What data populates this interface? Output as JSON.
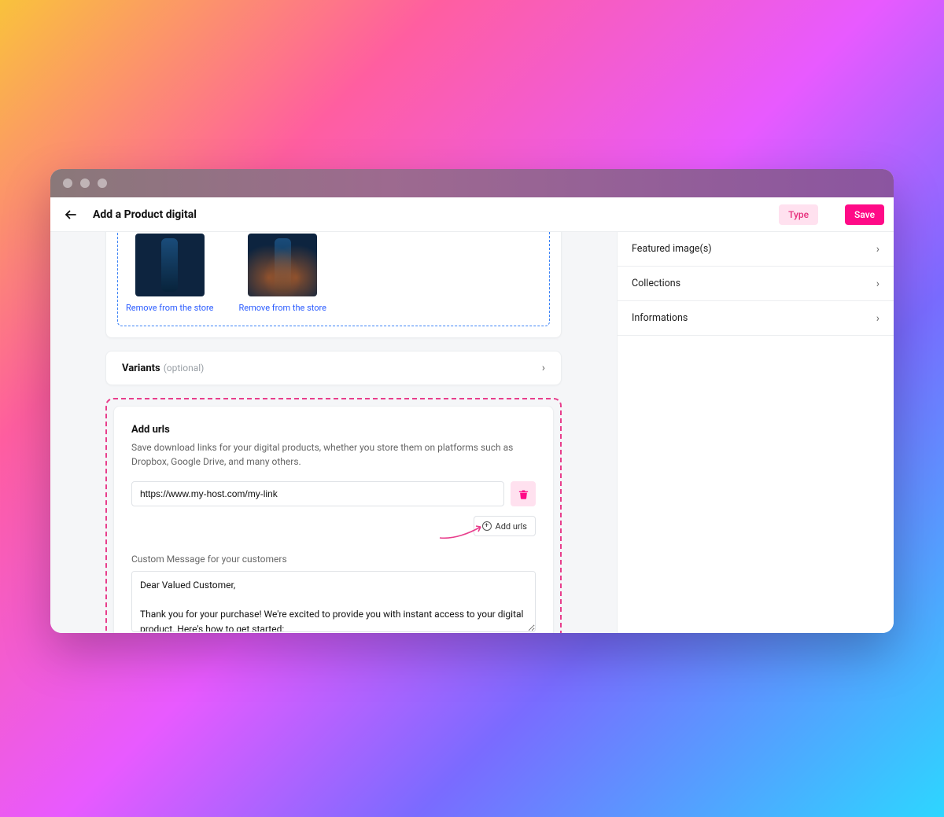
{
  "header": {
    "title": "Add a Product digital",
    "type_label": "Type",
    "save_label": "Save"
  },
  "images_panel": {
    "remove_label": "Remove from the store"
  },
  "variants_panel": {
    "label": "Variants",
    "optional_label": "(optional)"
  },
  "urls_panel": {
    "title": "Add urls",
    "description": "Save download links for your digital products, whether you store them on platforms such as Dropbox, Google Drive, and many others.",
    "url_value": "https://www.my-host.com/my-link",
    "add_button": "Add urls",
    "message_label": "Custom Message for your customers",
    "message_value": "Dear Valued Customer,\n\nThank you for your purchase! We're excited to provide you with instant access to your digital product. Here's how to get started:"
  },
  "sidebar": {
    "items": [
      {
        "label": "Featured image(s)"
      },
      {
        "label": "Collections"
      },
      {
        "label": "Informations"
      }
    ]
  },
  "colors": {
    "accent": "#ff0a87",
    "accent_light": "#ffe1ef",
    "highlight_dash": "#e83e8c",
    "link": "#2b5cff"
  }
}
